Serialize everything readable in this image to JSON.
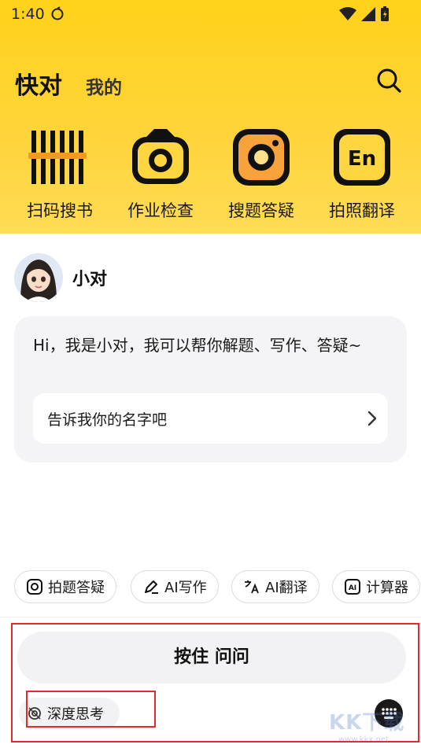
{
  "status_bar": {
    "time": "1:40"
  },
  "tabs": {
    "active": "快对",
    "inactive": "我的"
  },
  "tools": [
    {
      "label": "扫码搜书",
      "icon": "barcode-icon"
    },
    {
      "label": "作业检查",
      "icon": "camera-icon"
    },
    {
      "label": "搜题答疑",
      "icon": "camera-lens-icon"
    },
    {
      "label": "拍照翻译",
      "icon": "translate-en-icon"
    }
  ],
  "bot": {
    "name": "小对"
  },
  "chat": {
    "message": "Hi，我是小对，我可以帮你解题、写作、答疑~",
    "suggestion": "告诉我你的名字吧"
  },
  "chips": [
    {
      "label": "拍题答疑",
      "icon": "camera-icon"
    },
    {
      "label": "AI写作",
      "icon": "pen-icon"
    },
    {
      "label": "AI翻译",
      "icon": "translate-icon"
    },
    {
      "label": "计算器",
      "icon": "ai-calculator-icon"
    }
  ],
  "input": {
    "hold_label": "按住 问问",
    "deep_think_label": "深度思考"
  },
  "watermark": {
    "main": "KK下载",
    "sub": "www.kkx.net"
  },
  "colors": {
    "hero_yellow": "#ffd21a",
    "highlight_red": "#e22a2a"
  }
}
